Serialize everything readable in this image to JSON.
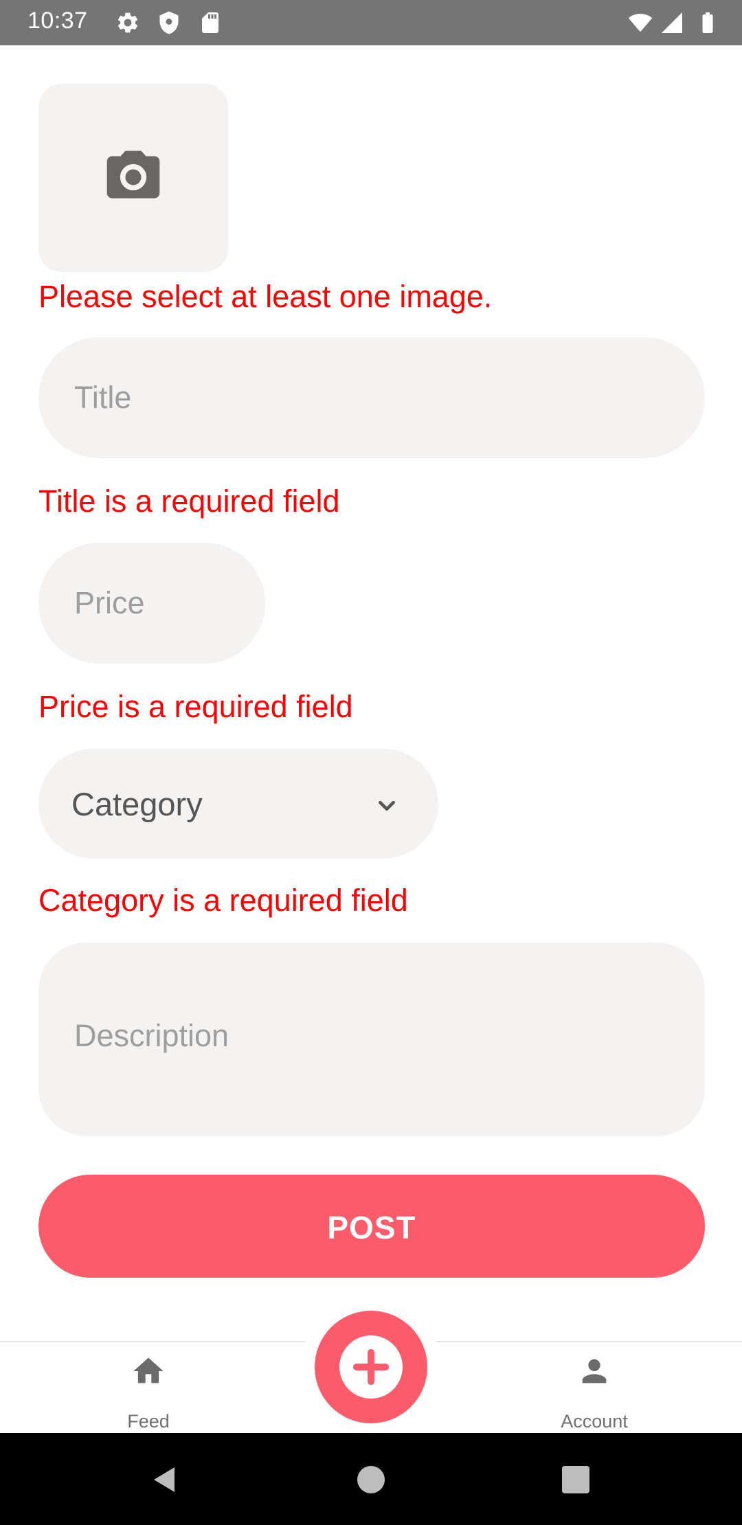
{
  "status_bar": {
    "time": "10:37",
    "icons_left": [
      "gear-icon",
      "shield-icon",
      "sd-card-icon"
    ],
    "icons_right": [
      "wifi-icon",
      "signal-icon",
      "battery-icon"
    ]
  },
  "image_picker": {
    "icon": "camera-icon",
    "error": "Please select at least one image."
  },
  "form": {
    "title": {
      "placeholder": "Title",
      "value": "",
      "error": "Title is a required field"
    },
    "price": {
      "placeholder": "Price",
      "value": "",
      "error": "Price is a required field"
    },
    "category": {
      "selected": "Category",
      "error": "Category is a required field"
    },
    "description": {
      "placeholder": "Description",
      "value": ""
    },
    "post_label": "POST"
  },
  "bottom_nav": {
    "feed_label": "Feed",
    "account_label": "Account",
    "add_icon": "plus-icon"
  },
  "colors": {
    "accent": "#fc5c6a",
    "error": "#ff0000",
    "field_bg": "#f5f2f2",
    "status_bar": "#757575"
  }
}
